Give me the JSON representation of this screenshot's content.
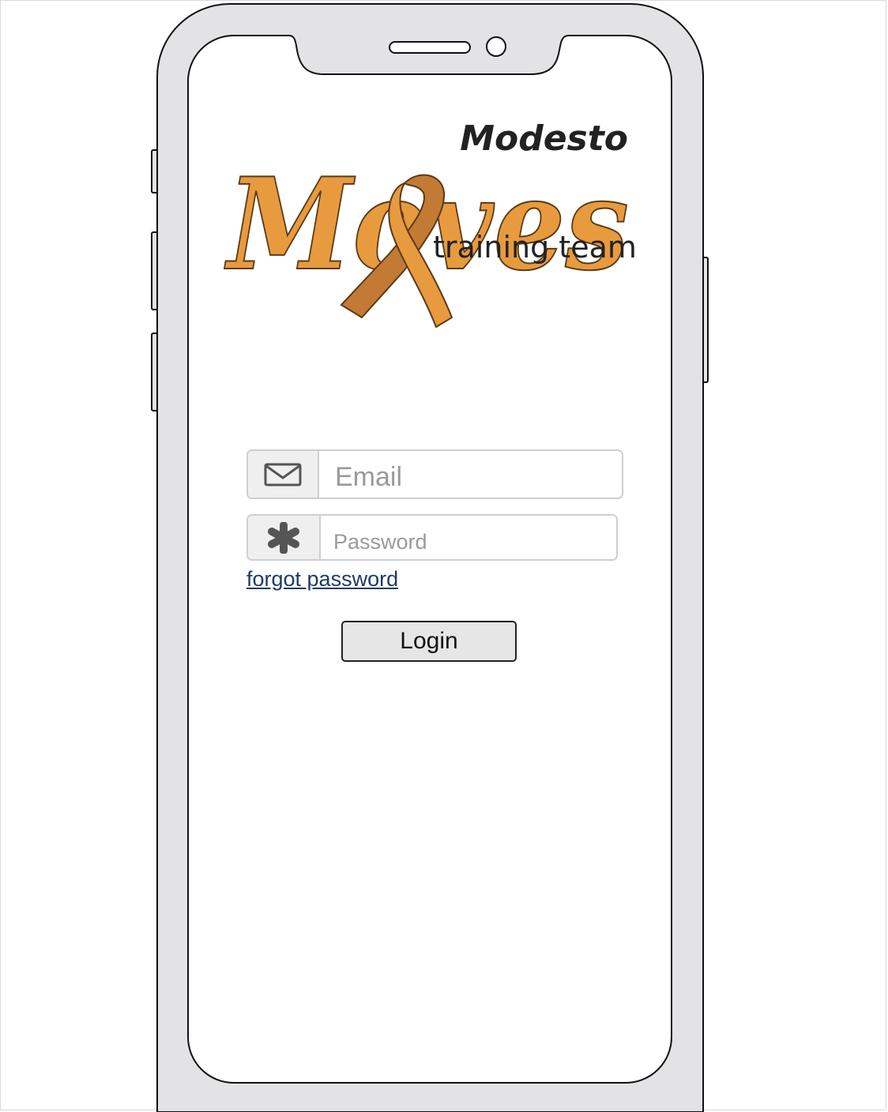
{
  "app": {
    "logo": {
      "line1": "Modesto",
      "line2": "Moves",
      "line3": "training team",
      "icon": "awareness-ribbon-icon"
    }
  },
  "login_form": {
    "email": {
      "placeholder": "Email",
      "value": "",
      "icon": "envelope-icon"
    },
    "password": {
      "placeholder": "Password",
      "value": "",
      "icon": "asterisk-icon"
    },
    "forgot_password_label": "forgot password",
    "login_label": "Login"
  },
  "colors": {
    "brand_orange": "#E89A3E",
    "ribbon_dark": "#C27A35",
    "link": "#1F3A68",
    "device_frame": "#E3E2E4"
  }
}
